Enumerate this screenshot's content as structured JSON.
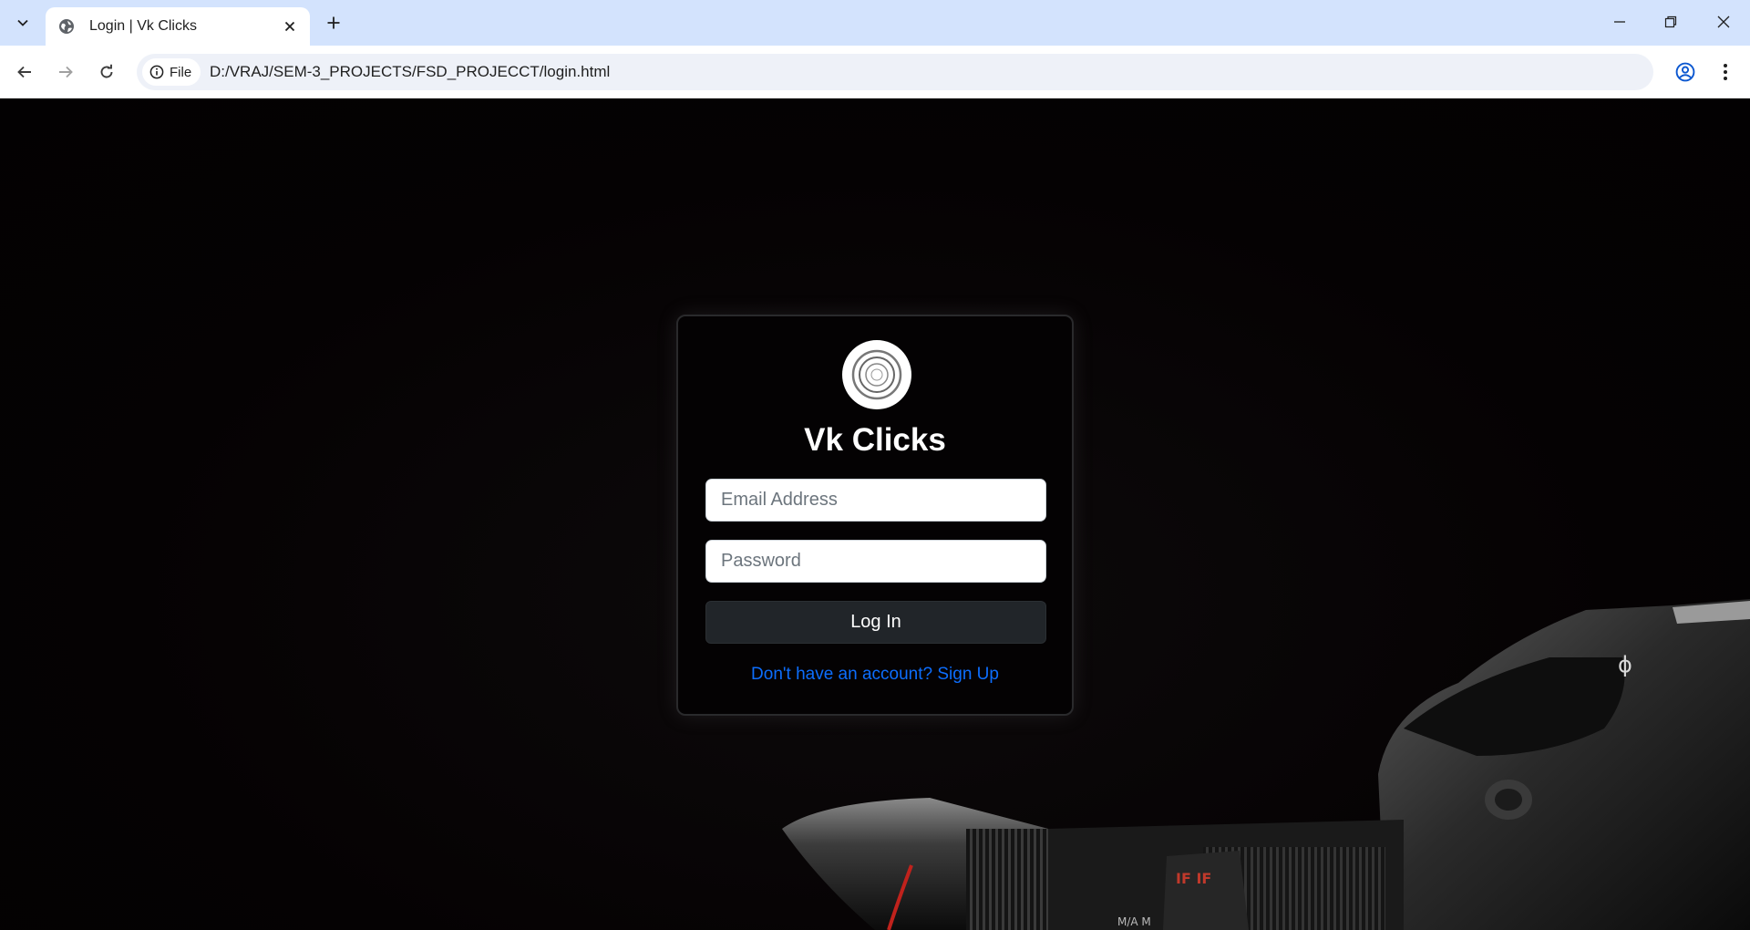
{
  "browser": {
    "tab_title": "Login | Vk Clicks",
    "chip_label": "File",
    "url": "D:/VRAJ/SEM-3_PROJECTS/FSD_PROJECCT/login.html"
  },
  "login": {
    "brand": "Vk Clicks",
    "email_placeholder": "Email Address",
    "password_placeholder": "Password",
    "submit_label": "Log In",
    "signup_link": "Don't have an account? Sign Up"
  },
  "colors": {
    "page_background": "#050203",
    "card_background": "#040203",
    "button_background": "#212529",
    "link": "#0d6efd",
    "titlebar": "#d3e3fd"
  },
  "icons": [
    "tab-search-icon",
    "globe-icon",
    "close-icon",
    "plus-icon",
    "minimize-icon",
    "restore-icon",
    "back-arrow-icon",
    "forward-arrow-icon",
    "reload-icon",
    "info-icon",
    "star-icon",
    "profile-icon",
    "kebab-menu-icon",
    "camera-lens-logo-icon"
  ]
}
